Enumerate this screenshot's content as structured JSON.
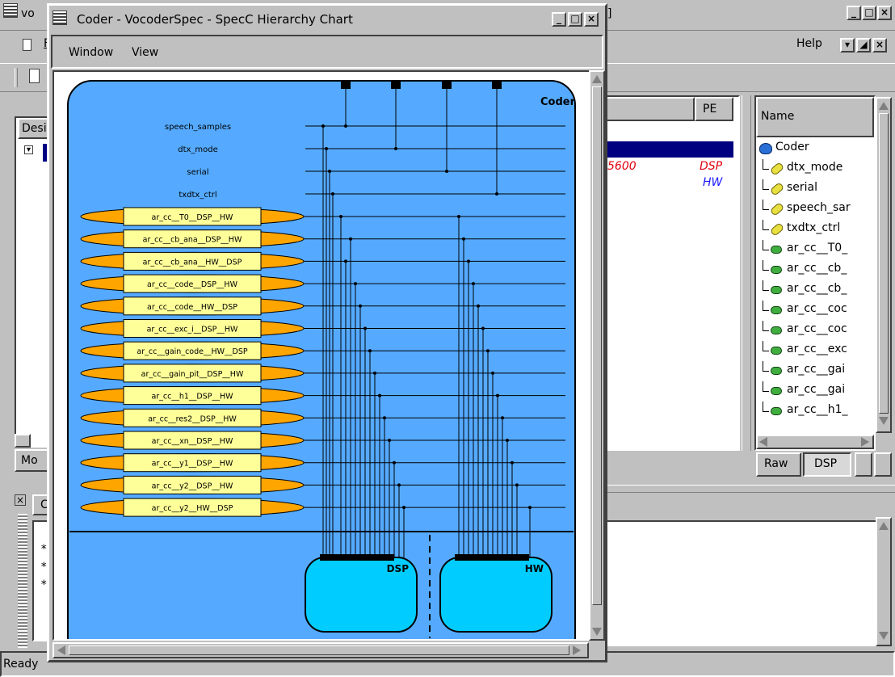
{
  "main_window": {
    "title_fragment": "vo",
    "title_suffix_fragment": "]",
    "menu_fragment": "F",
    "help_label": "Help",
    "tree_header_fragment": "Desi",
    "tab_fragment": "Mo",
    "console_tab_fragment": "C",
    "console_lines": [
      "*",
      "*",
      "*"
    ],
    "status": "Ready",
    "table": {
      "pe_header": "PE",
      "rows": [
        {
          "value": "5600",
          "pe": "DSP"
        },
        {
          "value": "",
          "pe": "HW"
        }
      ]
    },
    "name_tree": {
      "header": "Name",
      "items": [
        {
          "label": "Coder",
          "icon": "behavior-icon",
          "level": 0
        },
        {
          "label": "dtx_mode",
          "icon": "variable-icon",
          "level": 1
        },
        {
          "label": "serial",
          "icon": "variable-icon",
          "level": 1
        },
        {
          "label": "speech_sar",
          "icon": "variable-icon",
          "level": 1
        },
        {
          "label": "txdtx_ctrl",
          "icon": "variable-icon",
          "level": 1
        },
        {
          "label": "ar_cc__T0_",
          "icon": "channel-icon",
          "level": 1
        },
        {
          "label": "ar_cc__cb_",
          "icon": "channel-icon",
          "level": 1
        },
        {
          "label": "ar_cc__cb_",
          "icon": "channel-icon",
          "level": 1
        },
        {
          "label": "ar_cc__coc",
          "icon": "channel-icon",
          "level": 1
        },
        {
          "label": "ar_cc__coc",
          "icon": "channel-icon",
          "level": 1
        },
        {
          "label": "ar_cc__exc",
          "icon": "channel-icon",
          "level": 1
        },
        {
          "label": "ar_cc__gai",
          "icon": "channel-icon",
          "level": 1
        },
        {
          "label": "ar_cc__gai",
          "icon": "channel-icon",
          "level": 1
        },
        {
          "label": "ar_cc__h1_",
          "icon": "channel-icon",
          "level": 1
        }
      ],
      "tabs": [
        "Raw",
        "DSP"
      ]
    }
  },
  "chart_window": {
    "title": "Coder - VocoderSpec - SpecC Hierarchy Chart",
    "menu": [
      "Window",
      "View"
    ],
    "diagram": {
      "behavior_name": "Coder",
      "variables": [
        "speech_samples",
        "dtx_mode",
        "serial",
        "txdtx_ctrl"
      ],
      "channels": [
        "ar_cc__T0__DSP__HW",
        "ar_cc__cb_ana__DSP__HW",
        "ar_cc__cb_ana__HW__DSP",
        "ar_cc__code__DSP__HW",
        "ar_cc__code__HW__DSP",
        "ar_cc__exc_i__DSP__HW",
        "ar_cc__gain_code__HW__DSP",
        "ar_cc__gain_pit__DSP__HW",
        "ar_cc__h1__DSP__HW",
        "ar_cc__res2__DSP__HW",
        "ar_cc__xn__DSP__HW",
        "ar_cc__y1__DSP__HW",
        "ar_cc__y2__DSP__HW",
        "ar_cc__y2__HW__DSP"
      ],
      "child_behaviors": [
        "DSP",
        "HW"
      ],
      "colors": {
        "background": "#55aaff",
        "channel_fill": "#ffa500",
        "channel_label_fill": "#ffff99",
        "child_fill": "#00ccff"
      }
    }
  }
}
